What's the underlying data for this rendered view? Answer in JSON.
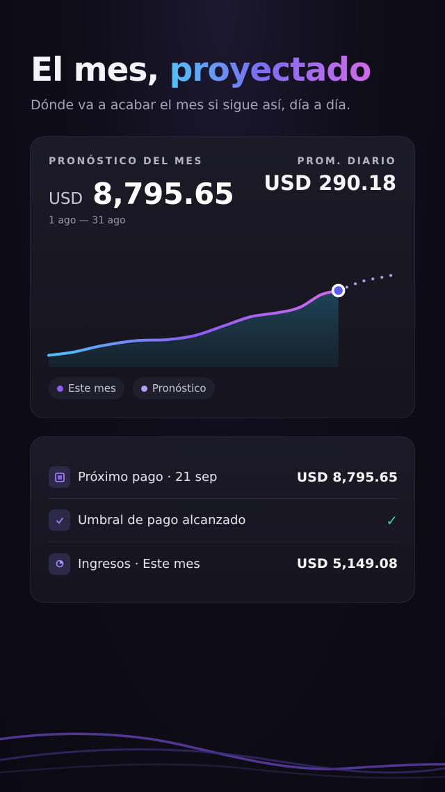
{
  "header": {
    "title_plain": "El mes,",
    "title_accent": "proyectado",
    "subtitle": "Dónde va a acabar el mes si sigue así, día a día."
  },
  "forecast": {
    "eyebrow": "PRONÓSTICO DEL MES",
    "currency": "USD",
    "amount": "8,795.65",
    "range": "1 ago — 31 ago",
    "daily_label": "PROM. DIARIO",
    "daily_value": "USD 290.18",
    "legend": [
      {
        "label": "Este mes",
        "color": "#8b5cf6"
      },
      {
        "label": "Pronóstico",
        "color": "#b69cf8"
      }
    ]
  },
  "chart_data": {
    "type": "line",
    "title": "",
    "xlabel": "",
    "ylabel": "",
    "series": [
      {
        "name": "Este mes",
        "x": [
          0,
          0.07,
          0.15,
          0.25,
          0.34,
          0.42,
          0.5,
          0.58,
          0.66,
          0.72,
          0.78,
          0.83
        ],
        "values": [
          0.11,
          0.14,
          0.2,
          0.25,
          0.26,
          0.3,
          0.39,
          0.48,
          0.52,
          0.57,
          0.69,
          0.73
        ]
      },
      {
        "name": "Pronóstico",
        "x": [
          0.83,
          0.9,
          0.96,
          1.0
        ],
        "values": [
          0.73,
          0.82,
          0.86,
          0.89
        ]
      }
    ],
    "colors": {
      "actual_start": "#4fc3f7",
      "actual_mid": "#8b5cf6",
      "actual_end": "#d16ae8",
      "forecast": "#b69cf8",
      "area": "#1a3a4c"
    }
  },
  "summary": {
    "rows": [
      {
        "icon": "calendar-icon",
        "label": "Próximo pago · 21 sep",
        "value": "USD 8,795.65"
      },
      {
        "icon": "check-icon",
        "label": "Umbral de pago alcanzado",
        "value": "✓"
      },
      {
        "icon": "pie-icon",
        "label": "Ingresos · Este mes",
        "value": "USD 5,149.08"
      }
    ]
  }
}
